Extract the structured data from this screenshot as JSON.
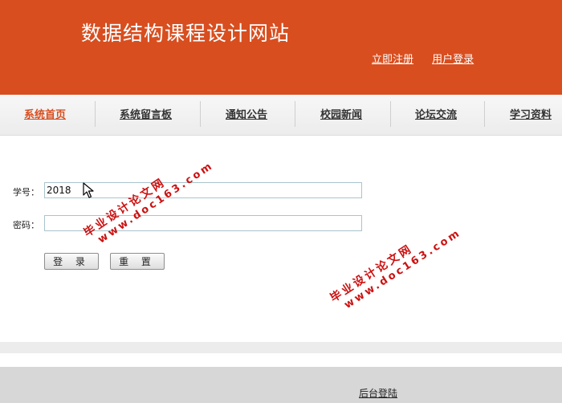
{
  "header": {
    "site_title": "数据结构课程设计网站",
    "register_link": "立即注册",
    "login_link": "用户登录"
  },
  "nav": {
    "items": [
      {
        "label": "系统首页",
        "active": true
      },
      {
        "label": "系统留言板"
      },
      {
        "label": "通知公告"
      },
      {
        "label": "校园新闻"
      },
      {
        "label": "论坛交流"
      },
      {
        "label": "学习资料"
      }
    ]
  },
  "login_form": {
    "student_id_label": "学号：",
    "student_id_value": "2018",
    "password_label": "密码：",
    "password_value": "",
    "login_button": "登 录",
    "reset_button": "重 置"
  },
  "footer": {
    "admin_login_link": "后台登陆"
  },
  "watermark": {
    "line1": "毕业设计论文网",
    "line2": "www.doc163.com",
    "color": "#cc1111"
  },
  "colors": {
    "brand": "#d84e1f",
    "nav_active": "#d84e1f"
  }
}
